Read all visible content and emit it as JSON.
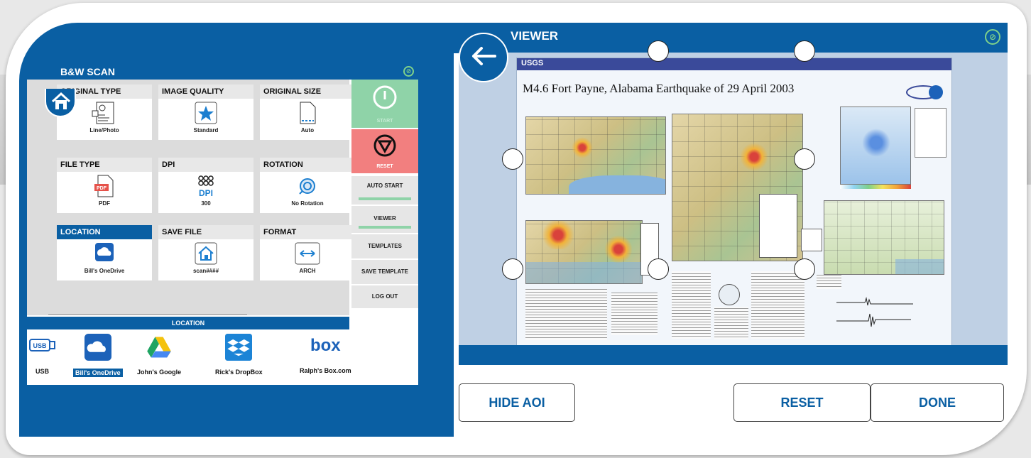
{
  "scan": {
    "title": "B&W SCAN",
    "options": [
      {
        "id": "original-type",
        "label": "ORIGINAL TYPE",
        "value": "Line/Photo",
        "icon": "line-photo-icon"
      },
      {
        "id": "image-quality",
        "label": "IMAGE QUALITY",
        "value": "Standard",
        "icon": "star-icon"
      },
      {
        "id": "original-size",
        "label": "ORIGINAL SIZE",
        "value": "Auto",
        "icon": "page-icon"
      },
      {
        "id": "file-type",
        "label": "FILE TYPE",
        "value": "PDF",
        "icon": "pdf-icon"
      },
      {
        "id": "dpi",
        "label": "DPI",
        "value": "300",
        "icon": "dpi-icon"
      },
      {
        "id": "rotation",
        "label": "ROTATION",
        "value": "No Rotation",
        "icon": "rotation-icon"
      },
      {
        "id": "location",
        "label": "LOCATION",
        "value": "Bill's OneDrive",
        "icon": "onedrive-icon",
        "selected": true
      },
      {
        "id": "save-file",
        "label": "SAVE FILE",
        "value": "scan####",
        "icon": "home-doc-icon"
      },
      {
        "id": "format",
        "label": "FORMAT",
        "value": "ARCH",
        "icon": "arrows-icon"
      }
    ],
    "dpi_icon_text": "DPI",
    "pdf_icon_text": "PDF",
    "side": {
      "start": "START",
      "reset": "RESET",
      "auto_start": "AUTO START",
      "viewer": "VIEWER",
      "templates": "TEMPLATES",
      "save_template": "SAVE TEMPLATE",
      "log_out": "LOG OUT"
    },
    "location_title": "LOCATION",
    "locations": [
      {
        "name": "USB",
        "icon": "usb-icon",
        "icon_text": "USB"
      },
      {
        "name": "Bill's OneDrive",
        "icon": "onedrive-icon",
        "selected": true
      },
      {
        "name": "John's Google",
        "icon": "google-drive-icon"
      },
      {
        "name": "Rick's DropBox",
        "icon": "dropbox-icon"
      },
      {
        "name": "Ralph's Box.com",
        "icon": "box-icon",
        "icon_text": "box"
      }
    ]
  },
  "viewer": {
    "title": "VIEWER",
    "doc": {
      "agency": "USGS",
      "title": "M4.6 Fort Payne, Alabama Earthquake of 29 April 2003"
    },
    "buttons": {
      "hide_aoi": "HIDE AOI",
      "reset": "RESET",
      "done": "DONE"
    }
  },
  "colors": {
    "primary": "#0a5fa3",
    "start": "#8fd3a8",
    "reset": "#f27f7f",
    "brand_logo": "#7ed08a"
  }
}
